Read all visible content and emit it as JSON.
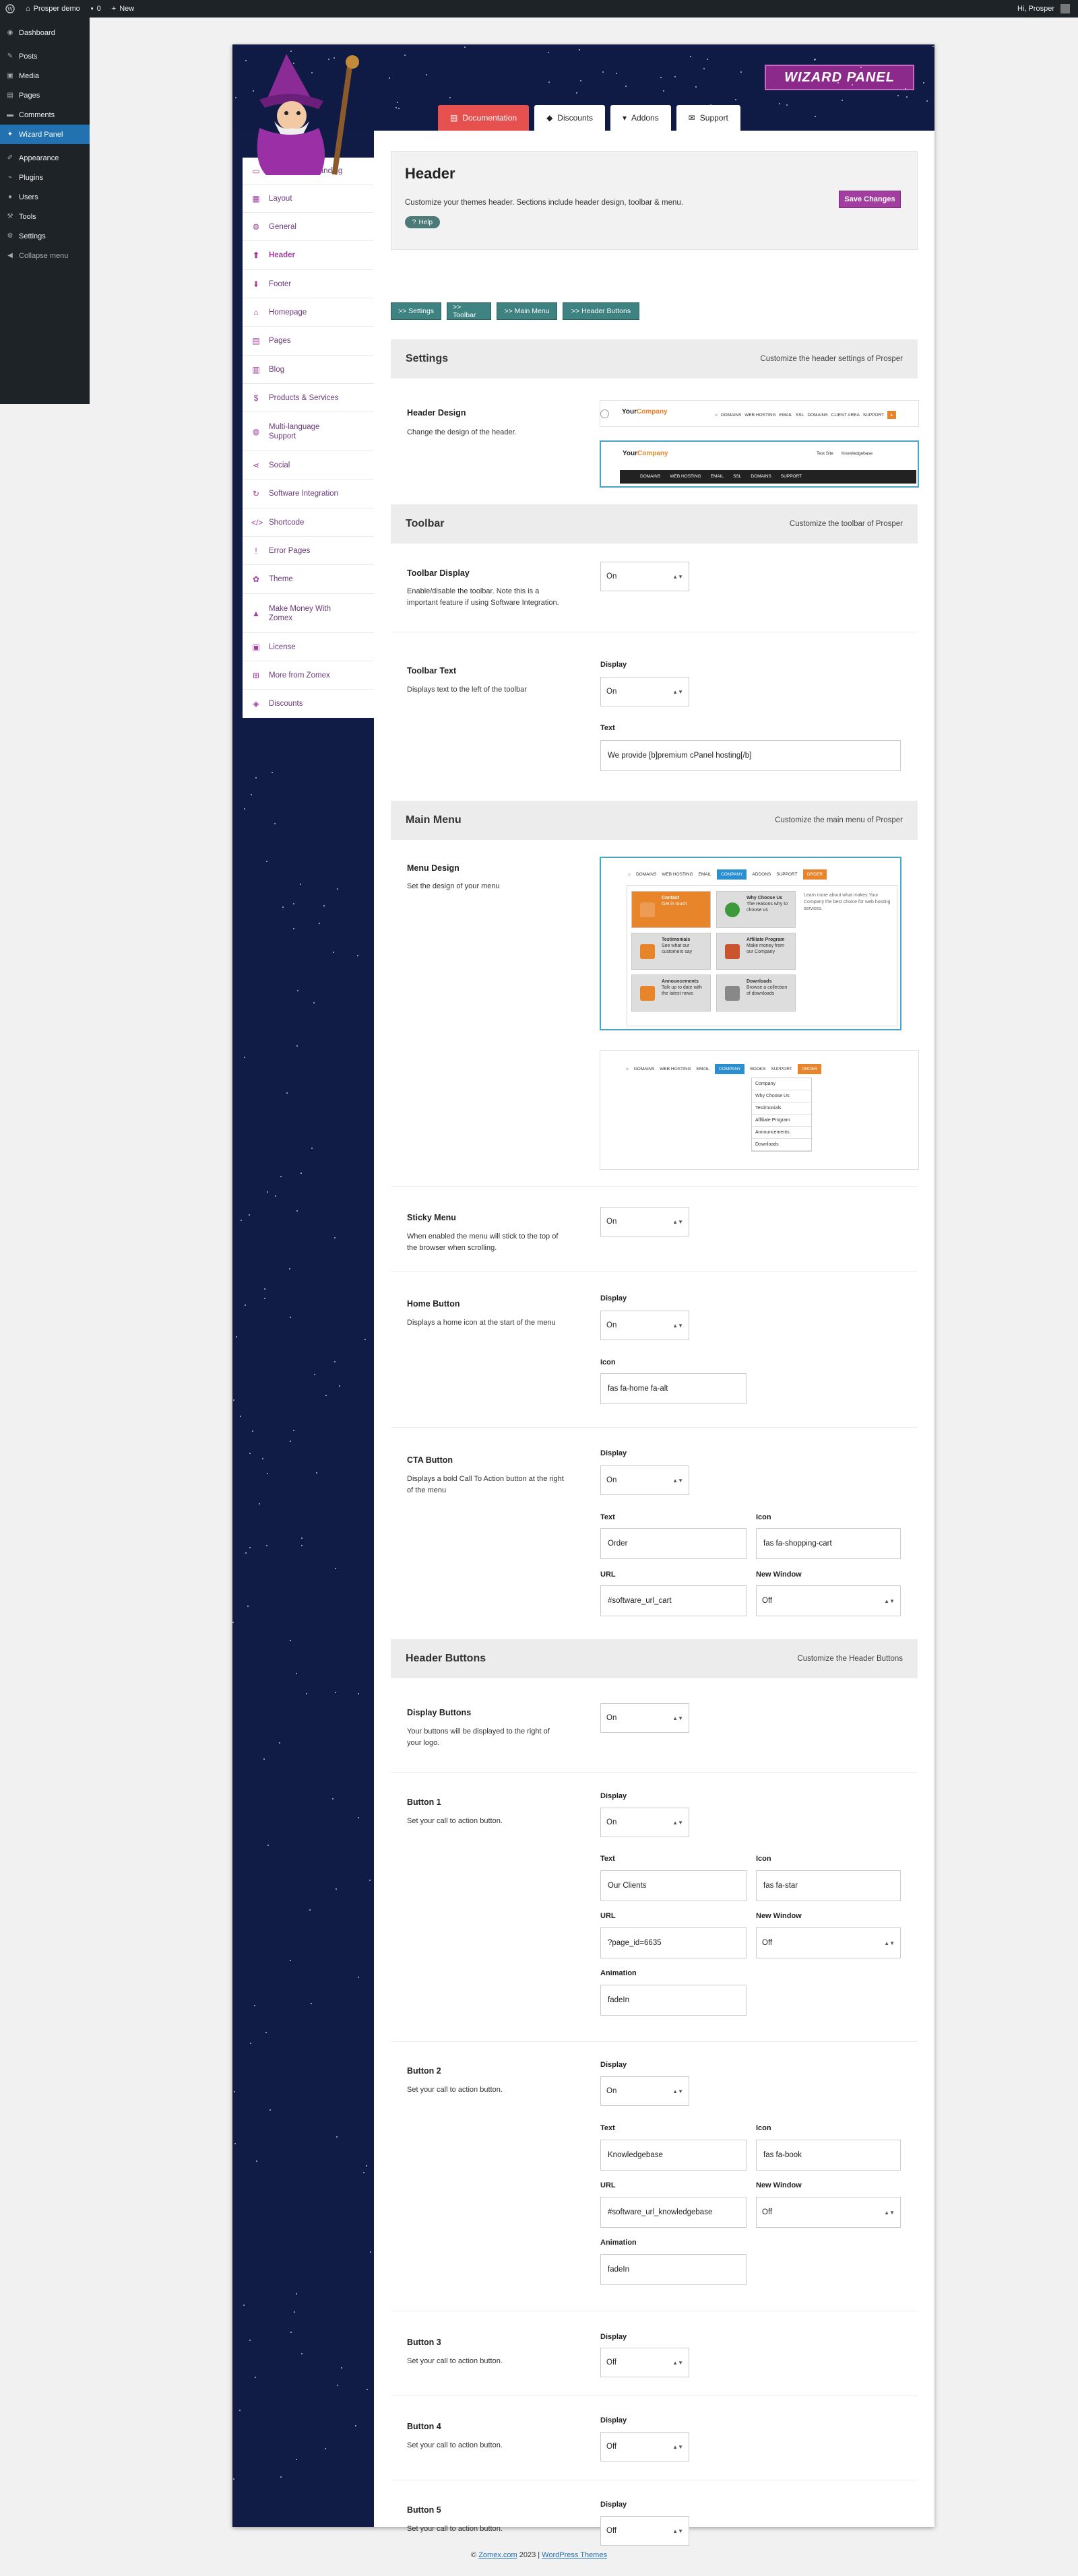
{
  "admin_bar": {
    "site_name": "Prosper demo",
    "comments_count": "0",
    "new_label": "New",
    "greeting": "Hi, Prosper"
  },
  "wp_menu": [
    {
      "label": "Dashboard",
      "icon": "dashboard-icon"
    },
    {
      "label": "Posts",
      "icon": "pin-icon"
    },
    {
      "label": "Media",
      "icon": "media-icon"
    },
    {
      "label": "Pages",
      "icon": "page-icon"
    },
    {
      "label": "Comments",
      "icon": "comment-icon"
    },
    {
      "label": "Wizard Panel",
      "icon": "wizard-icon",
      "active": true
    },
    {
      "label": "Appearance",
      "icon": "brush-icon"
    },
    {
      "label": "Plugins",
      "icon": "plug-icon"
    },
    {
      "label": "Users",
      "icon": "user-icon"
    },
    {
      "label": "Tools",
      "icon": "wrench-icon"
    },
    {
      "label": "Settings",
      "icon": "settings-icon"
    },
    {
      "label": "Collapse menu",
      "icon": "collapse-icon"
    }
  ],
  "logo_text": "WIZARD PANEL",
  "tabs": [
    {
      "label": "Documentation",
      "icon": "document-icon"
    },
    {
      "label": "Discounts",
      "icon": "tag-icon"
    },
    {
      "label": "Addons",
      "icon": "cart-icon"
    },
    {
      "label": "Support",
      "icon": "envelope-icon"
    }
  ],
  "sidenav": [
    {
      "label": "Company & Branding",
      "icon": "id-card-icon"
    },
    {
      "label": "Layout",
      "icon": "layout-icon"
    },
    {
      "label": "General",
      "icon": "gear-icon"
    },
    {
      "label": "Header",
      "icon": "header-icon",
      "active": true
    },
    {
      "label": "Footer",
      "icon": "footer-icon"
    },
    {
      "label": "Homepage",
      "icon": "home-icon"
    },
    {
      "label": "Pages",
      "icon": "file-icon"
    },
    {
      "label": "Blog",
      "icon": "blog-icon"
    },
    {
      "label": "Products & Services",
      "icon": "dollar-icon"
    },
    {
      "label": "Multi-language Support",
      "icon": "globe-icon"
    },
    {
      "label": "Social",
      "icon": "share-icon"
    },
    {
      "label": "Software Integration",
      "icon": "refresh-icon"
    },
    {
      "label": "Shortcode",
      "icon": "code-icon"
    },
    {
      "label": "Error Pages",
      "icon": "exclamation-icon"
    },
    {
      "label": "Theme",
      "icon": "palette-icon"
    },
    {
      "label": "Make Money With Zomex",
      "icon": "money-icon"
    },
    {
      "label": "License",
      "icon": "key-icon"
    },
    {
      "label": "More from Zomex",
      "icon": "plus-icon"
    },
    {
      "label": "Discounts",
      "icon": "tags-icon"
    }
  ],
  "header": {
    "title": "Header",
    "description": "Customize your themes header. Sections include header design, toolbar & menu.",
    "help_label": "Help",
    "save_label": "Save Changes"
  },
  "section_buttons": [
    ">> Settings",
    ">> Toolbar",
    ">> Main Menu",
    ">> Header Buttons"
  ],
  "sections": {
    "settings": {
      "title": "Settings",
      "subtitle": "Customize the header settings of Prosper"
    },
    "toolbar": {
      "title": "Toolbar",
      "subtitle": "Customize the toolbar of Prosper"
    },
    "main_menu": {
      "title": "Main Menu",
      "subtitle": "Customize the main menu of Prosper"
    },
    "header_buttons": {
      "title": "Header Buttons",
      "subtitle": "Customize the Header Buttons"
    }
  },
  "labels": {
    "display": "Display",
    "text": "Text",
    "icon": "Icon",
    "url": "URL",
    "new_window": "New Window",
    "animation": "Animation"
  },
  "header_design": {
    "title": "Header Design",
    "desc": "Change the design of the header.",
    "brand_a": "Your",
    "brand_b": "Company",
    "nav1": [
      "DOMAINS",
      "WEB HOSTING",
      "EMAIL",
      "SSL",
      "DOMAINS",
      "CLIENT AREA",
      "SUPPORT"
    ],
    "nav2_links": [
      "Test Site",
      "Knowledgebase"
    ],
    "nav2": [
      "DOMAINS",
      "WEB HOSTING",
      "EMAIL",
      "SSL",
      "DOMAINS",
      "SUPPORT"
    ]
  },
  "toolbar_display": {
    "title": "Toolbar Display",
    "desc": "Enable/disable the toolbar. Note this is a important feature if using Software Integration.",
    "value": "On"
  },
  "toolbar_text": {
    "title": "Toolbar Text",
    "desc": "Displays text to the left of the toolbar",
    "display": "On",
    "text": "We provide [b]premium cPanel hosting[/b]"
  },
  "menu_design": {
    "title": "Menu Design",
    "desc": "Set the design of your menu",
    "nav": [
      "DOMAINS",
      "WEB HOSTING",
      "EMAIL",
      "COMPANY",
      "ADDONS",
      "SUPPORT",
      "ORDER"
    ],
    "nav_b": [
      "DOMAINS",
      "WEB HOSTING",
      "EMAIL",
      "COMPANY",
      "BOOKS",
      "SUPPORT",
      "ORDER"
    ],
    "tiles": [
      {
        "title": "Contact",
        "text": "Get in touch"
      },
      {
        "title": "Why Choose Us",
        "text": "The reasons why to choose us"
      },
      {
        "title": "Testimonials",
        "text": "See what our customers say"
      },
      {
        "title": "Affiliate Program",
        "text": "Make money from our Company"
      },
      {
        "title": "Announcements",
        "text": "Talk up to date with the latest news"
      },
      {
        "title": "Downloads",
        "text": "Browse a collection of downloads"
      }
    ],
    "side_text": "Learn more about what makes Your Company the best choice for web hosting services.",
    "dropdown": [
      "Company",
      "Why Choose Us",
      "Testimonials",
      "Affiliate Program",
      "Announcements",
      "Downloads"
    ]
  },
  "sticky_menu": {
    "title": "Sticky Menu",
    "desc": "When enabled the menu will stick to the top of the browser when scrolling.",
    "value": "On"
  },
  "home_button": {
    "title": "Home Button",
    "desc": "Displays a home icon at the start of the menu",
    "display": "On",
    "icon": "fas fa-home fa-alt"
  },
  "cta_button": {
    "title": "CTA Button",
    "desc": "Displays a bold Call To Action button at the right of the menu",
    "display": "On",
    "text": "Order",
    "icon": "fas fa-shopping-cart",
    "url": "#software_url_cart",
    "new_window": "Off"
  },
  "display_buttons": {
    "title": "Display Buttons",
    "desc": "Your buttons will be displayed to the right of your logo.",
    "value": "On"
  },
  "button1": {
    "title": "Button 1",
    "desc": "Set your call to action button.",
    "display": "On",
    "text": "Our Clients",
    "icon": "fas fa-star",
    "url": "?page_id=6635",
    "new_window": "Off",
    "animation": "fadeIn"
  },
  "button2": {
    "title": "Button 2",
    "desc": "Set your call to action button.",
    "display": "On",
    "text": "Knowledgebase",
    "icon": "fas fa-book",
    "url": "#software_url_knowledgebase",
    "new_window": "Off",
    "animation": "fadeIn"
  },
  "button3": {
    "title": "Button 3",
    "desc": "Set your call to action button.",
    "display": "Off"
  },
  "button4": {
    "title": "Button 4",
    "desc": "Set your call to action button.",
    "display": "Off"
  },
  "button5": {
    "title": "Button 5",
    "desc": "Set your call to action button.",
    "display": "Off"
  },
  "footer": {
    "prefix": "© ",
    "link1": "Zomex.com",
    "middle": " 2023 | ",
    "link2": "WordPress Themes"
  },
  "colors": {
    "accent": "#a23ea0",
    "panel_bg": "#101c45",
    "teal": "#3e8282",
    "red_tab": "#e6504f",
    "wp_active": "#2271b1"
  }
}
